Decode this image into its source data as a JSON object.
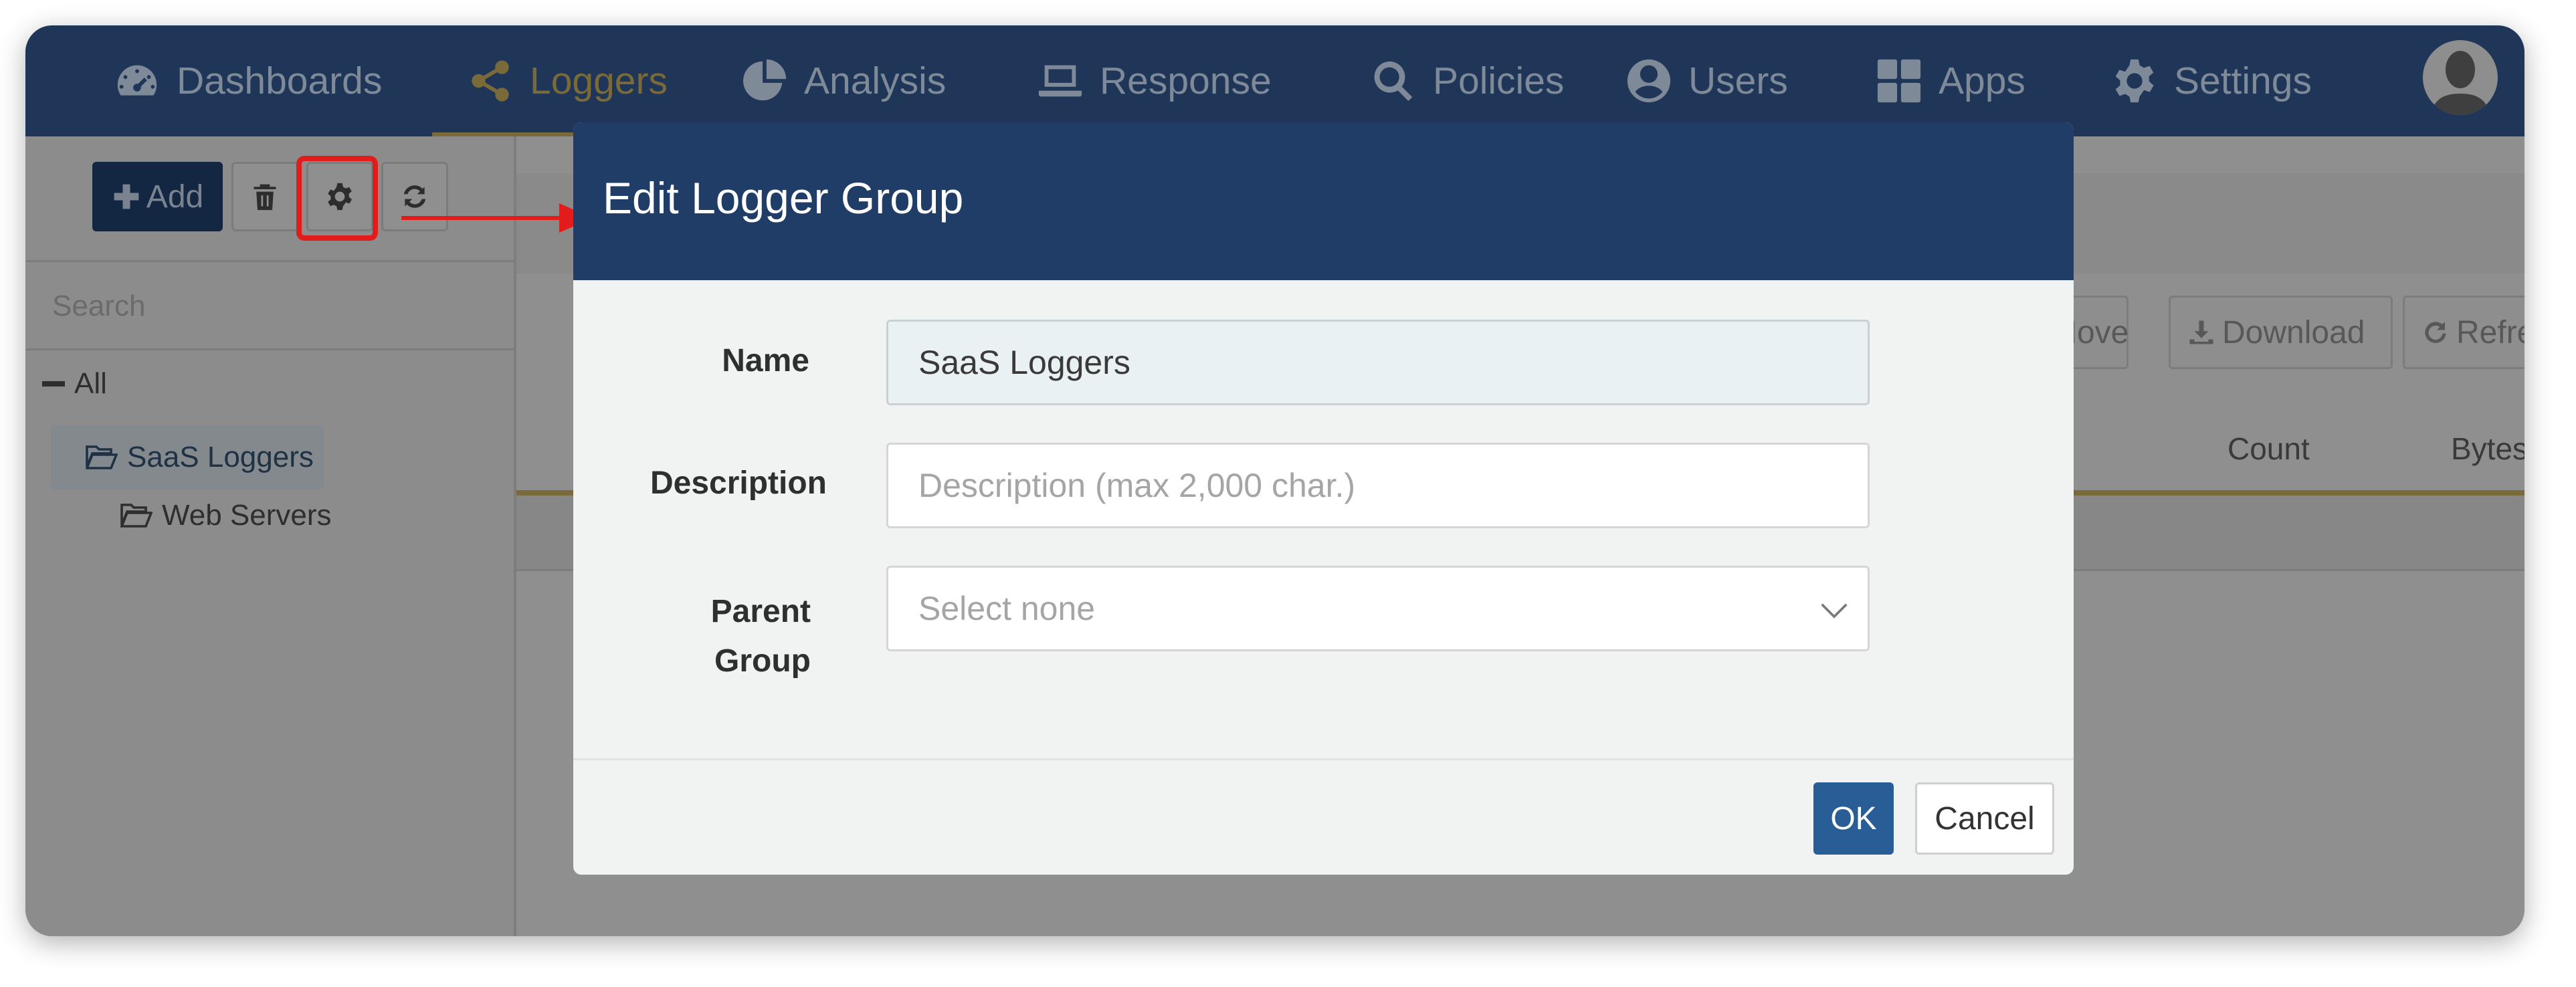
{
  "nav": {
    "items": [
      {
        "label": "Dashboards",
        "icon": "dashboard-icon"
      },
      {
        "label": "Loggers",
        "icon": "share-icon",
        "active": true
      },
      {
        "label": "Analysis",
        "icon": "pie-chart-icon"
      },
      {
        "label": "Response",
        "icon": "laptop-icon"
      },
      {
        "label": "Policies",
        "icon": "search-icon"
      },
      {
        "label": "Users",
        "icon": "user-circle-icon"
      },
      {
        "label": "Apps",
        "icon": "grid-icon"
      },
      {
        "label": "Settings",
        "icon": "gear-icon"
      }
    ],
    "active_color": "#F0A30A"
  },
  "toolbar": {
    "add_label": "Add"
  },
  "sidebar": {
    "search_placeholder": "Search",
    "tree": {
      "root": "All",
      "groups": [
        {
          "label": "SaaS Loggers",
          "selected": true
        },
        {
          "label": "Web Servers"
        }
      ]
    }
  },
  "main": {
    "buttons": {
      "move": "Move",
      "download": "Download",
      "refresh": "Refres"
    },
    "columns": {
      "count": "Count",
      "bytes": "Bytes"
    }
  },
  "modal": {
    "title": "Edit Logger Group",
    "name_label": "Name",
    "name_value": "SaaS Loggers",
    "description_label": "Description",
    "description_placeholder": "Description (max 2,000 char.)",
    "parent_label_line1": "Parent",
    "parent_label_line2": "Group",
    "parent_value": "Select none",
    "ok_label": "OK",
    "cancel_label": "Cancel"
  },
  "annotation": {
    "color": "#E21B1B"
  }
}
